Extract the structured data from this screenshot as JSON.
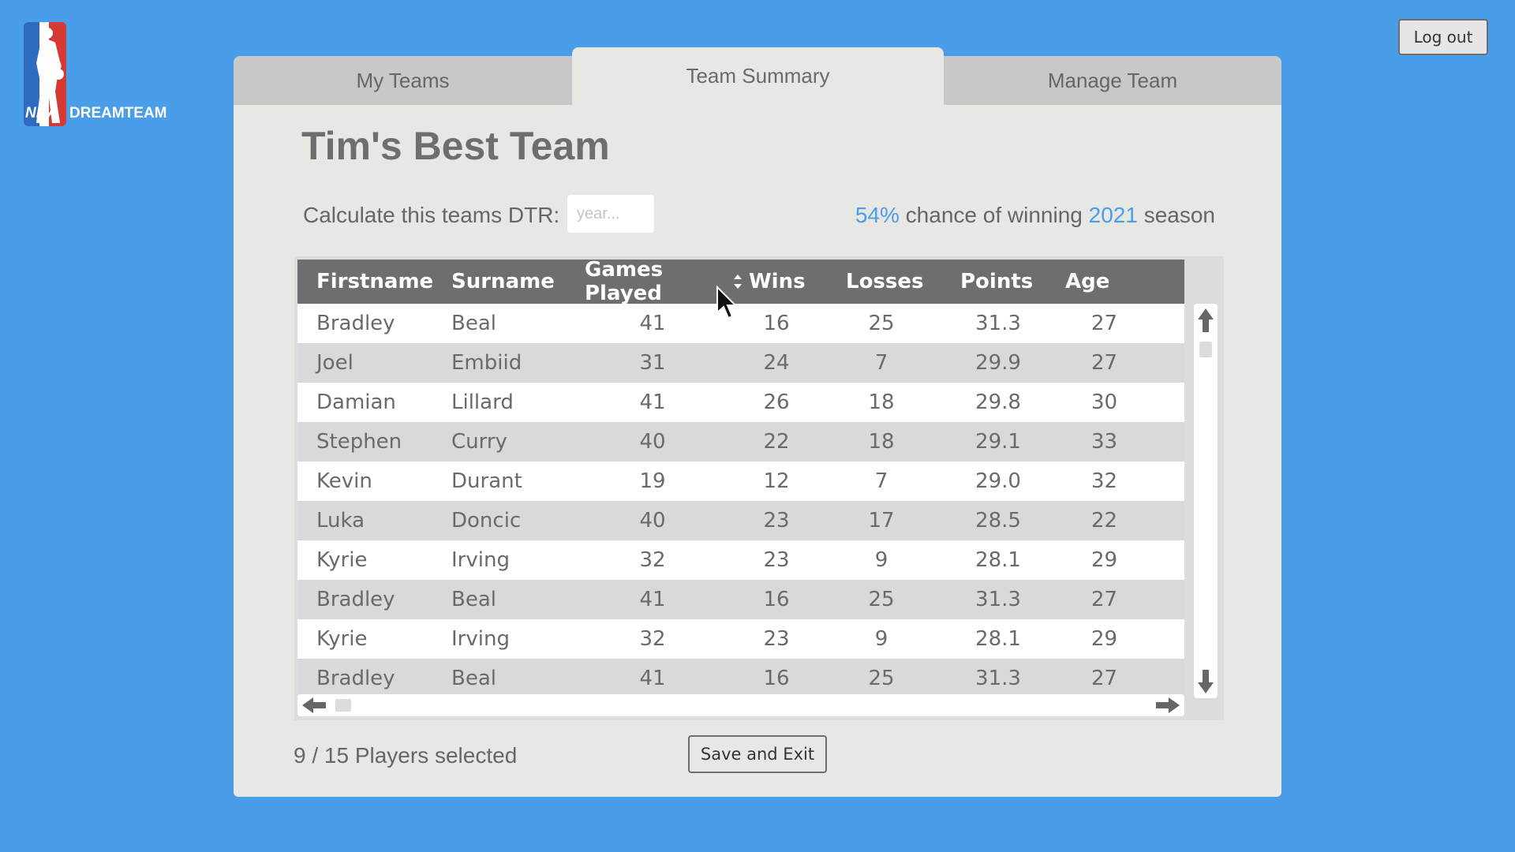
{
  "app": {
    "logo": {
      "icon": "nba-dreamteam-logo",
      "text": "DREAMTEAM",
      "badge_text": "NBA"
    },
    "logout_label": "Log out"
  },
  "tabs": [
    {
      "label": "My Teams",
      "active": false
    },
    {
      "label": "Team Summary",
      "active": true
    },
    {
      "label": "Manage Team",
      "active": false
    }
  ],
  "team": {
    "title": "Tim's Best Team",
    "dtr_label": "Calculate this teams DTR:",
    "year_placeholder": "year...",
    "year_value": "",
    "chance_percent": "54%",
    "chance_text": " chance of winning ",
    "season_year": "2021",
    "season_text": " season"
  },
  "table": {
    "columns": [
      "Firstname",
      "Surname",
      "Games Played",
      "Wins",
      "Losses",
      "Points",
      "Age"
    ],
    "sorted_column": "Games Played",
    "rows": [
      [
        "Bradley",
        "Beal",
        "41",
        "16",
        "25",
        "31.3",
        "27"
      ],
      [
        "Joel",
        "Embiid",
        "31",
        "24",
        "7",
        "29.9",
        "27"
      ],
      [
        "Damian",
        "Lillard",
        "41",
        "26",
        "18",
        "29.8",
        "30"
      ],
      [
        "Stephen",
        "Curry",
        "40",
        "22",
        "18",
        "29.1",
        "33"
      ],
      [
        "Kevin",
        "Durant",
        "19",
        "12",
        "7",
        "29.0",
        "32"
      ],
      [
        "Luka",
        "Doncic",
        "40",
        "23",
        "17",
        "28.5",
        "22"
      ],
      [
        "Kyrie",
        "Irving",
        "32",
        "23",
        "9",
        "28.1",
        "29"
      ],
      [
        "Bradley",
        "Beal",
        "41",
        "16",
        "25",
        "31.3",
        "27"
      ],
      [
        "Kyrie",
        "Irving",
        "32",
        "23",
        "9",
        "28.1",
        "29"
      ],
      [
        "Bradley",
        "Beal",
        "41",
        "16",
        "25",
        "31.3",
        "27"
      ]
    ]
  },
  "footer": {
    "players_selected": "9 / 15 Players selected",
    "save_label": "Save and Exit"
  },
  "colors": {
    "background": "#4a9de9",
    "accent": "#4a9de9",
    "panel": "#e7e7e3",
    "header": "#6e6e6e"
  }
}
